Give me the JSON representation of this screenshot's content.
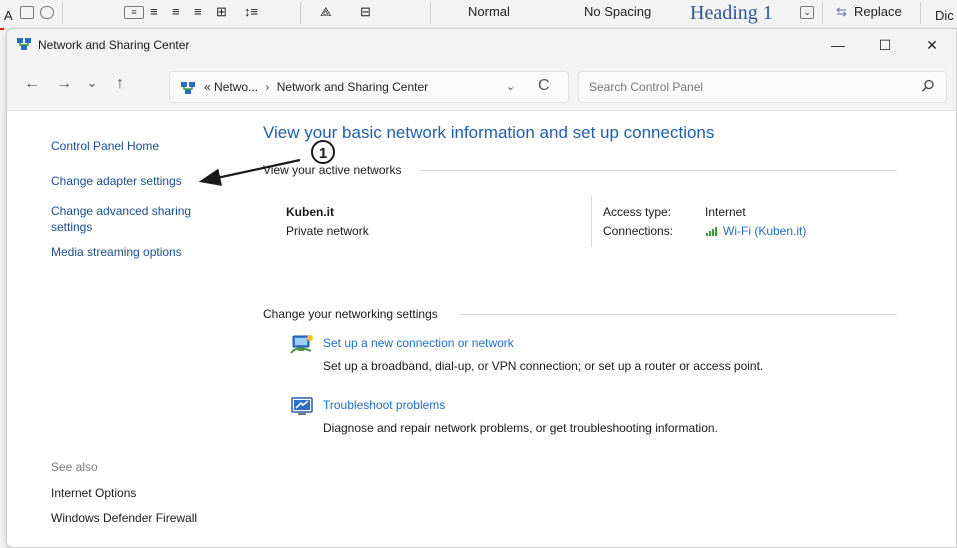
{
  "ribbon": {
    "font_fragment": "A",
    "style_normal": "Normal",
    "style_no_spacing": "No Spacing",
    "style_heading1": "Heading 1",
    "replace": "Replace",
    "dictate_fragment": "Dic"
  },
  "window": {
    "title": "Network and Sharing Center",
    "icon": "network-center-icon",
    "controls": {
      "minimize": "—",
      "maximize": "☐",
      "close": "✕"
    }
  },
  "address": {
    "crumb_prefix": "«",
    "crumb_1": "Netwo...",
    "crumb_sep": "›",
    "crumb_2": "Network and Sharing Center",
    "search_placeholder": "Search Control Panel"
  },
  "nav": {
    "back": "←",
    "forward": "→",
    "recent": "⌄",
    "up": "↑",
    "dropdown": "⌄",
    "refresh": "C"
  },
  "left_pane": {
    "home": "Control Panel Home",
    "links": [
      "Change adapter settings",
      "Change advanced sharing settings",
      "Media streaming options"
    ],
    "see_also_label": "See also",
    "see_also": [
      "Internet Options",
      "Windows Defender Firewall"
    ]
  },
  "main": {
    "title": "View your basic network information and set up connections",
    "active_networks_heading": "View your active networks",
    "network": {
      "name": "Kuben.it",
      "type": "Private network",
      "access_type_label": "Access type:",
      "access_type_value": "Internet",
      "connections_label": "Connections:",
      "connections_value": "Wi-Fi (Kuben.it)"
    },
    "change_heading": "Change your networking settings",
    "tasks": [
      {
        "link": "Set up a new connection or network",
        "desc": "Set up a broadband, dial-up, or VPN connection; or set up a router or access point.",
        "icon": "network-setup-icon"
      },
      {
        "link": "Troubleshoot problems",
        "desc": "Diagnose and repair network problems, or get troubleshooting information.",
        "icon": "troubleshoot-icon"
      }
    ]
  },
  "annotation": {
    "number": "1",
    "color": "#1a1a1a"
  },
  "colors": {
    "link": "#1f6fc0",
    "title": "#1f5fa8",
    "left_link": "#1a4d8f"
  }
}
